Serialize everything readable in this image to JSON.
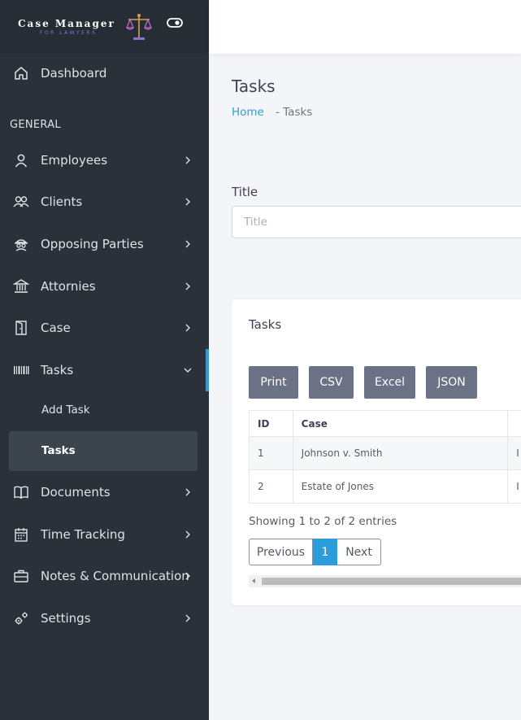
{
  "brand": {
    "title": "Case Manager",
    "subtitle": "FOR LAWYERS"
  },
  "sidebar": {
    "dashboard": "Dashboard",
    "section": "GENERAL",
    "items": [
      {
        "label": "Employees",
        "icon": "user-icon"
      },
      {
        "label": "Clients",
        "icon": "users-icon"
      },
      {
        "label": "Opposing Parties",
        "icon": "spy-icon"
      },
      {
        "label": "Attornies",
        "icon": "bank-icon"
      },
      {
        "label": "Case",
        "icon": "door-icon"
      },
      {
        "label": "Tasks",
        "icon": "barcode-icon"
      },
      {
        "label": "Documents",
        "icon": "book-icon"
      },
      {
        "label": "Time Tracking",
        "icon": "calendar-icon"
      },
      {
        "label": "Notes & Communication",
        "icon": "briefcase-icon"
      },
      {
        "label": "Settings",
        "icon": "gears-icon"
      }
    ],
    "tasks_submenu": [
      "Add Task",
      "Tasks"
    ]
  },
  "page": {
    "title": "Tasks",
    "breadcrumb_home": "Home",
    "breadcrumb_current": "-  Tasks"
  },
  "filter": {
    "label": "Title",
    "placeholder": "Title",
    "value": ""
  },
  "card": {
    "title": "Tasks",
    "buttons": [
      "Print",
      "CSV",
      "Excel",
      "JSON"
    ],
    "columns": [
      "ID",
      "Case",
      ""
    ],
    "rows": [
      [
        "1",
        "Johnson v. Smith",
        "I"
      ],
      [
        "2",
        "Estate of Jones",
        "I"
      ]
    ],
    "info": "Showing 1 to 2 of 2 entries",
    "pagination": {
      "previous": "Previous",
      "current": "1",
      "next": "Next"
    }
  },
  "colors": {
    "sidebar_bg": "#2b3139",
    "accent": "#2d9cdb",
    "button_bg": "#6c7286"
  }
}
